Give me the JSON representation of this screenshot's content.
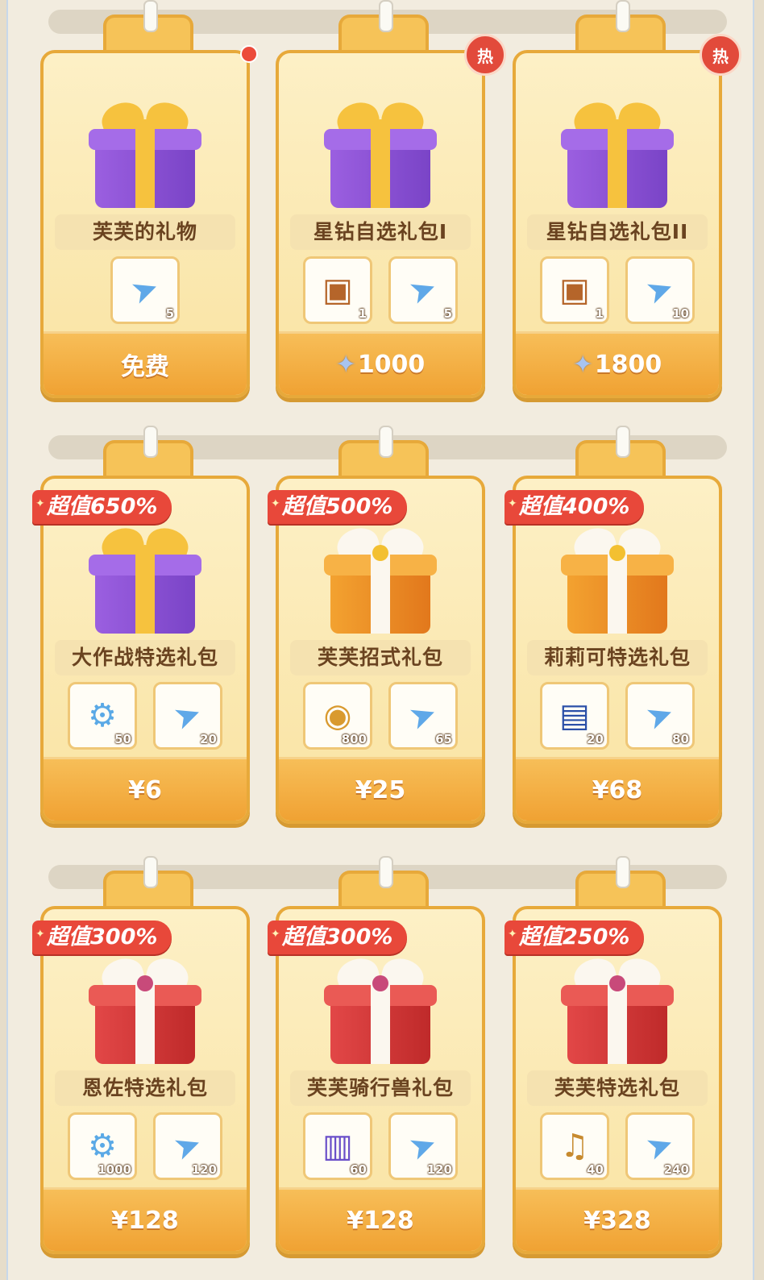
{
  "badges": {
    "hot_label": "热"
  },
  "rows": [
    {
      "cards": [
        {
          "gift": "purple-gift",
          "ribbon": "",
          "hot": false,
          "red_dot": true,
          "title": "芙芙的礼物",
          "price": "免费",
          "currency": "",
          "items": [
            {
              "icon": "paper-plane-icon",
              "qty": "5"
            }
          ]
        },
        {
          "gift": "purple-gift",
          "ribbon": "",
          "hot": true,
          "red_dot": false,
          "title": "星钻自选礼包I",
          "price": "1000",
          "currency": "star-diamond-icon",
          "items": [
            {
              "icon": "treasure-chest-icon",
              "qty": "1"
            },
            {
              "icon": "paper-plane-icon",
              "qty": "5"
            }
          ]
        },
        {
          "gift": "purple-gift",
          "ribbon": "",
          "hot": true,
          "red_dot": false,
          "title": "星钻自选礼包II",
          "price": "1800",
          "currency": "star-diamond-icon",
          "items": [
            {
              "icon": "treasure-chest-icon",
              "qty": "1"
            },
            {
              "icon": "paper-plane-icon",
              "qty": "10"
            }
          ]
        }
      ]
    },
    {
      "cards": [
        {
          "gift": "purple-gift",
          "ribbon": "超值650%",
          "hot": false,
          "red_dot": false,
          "title": "大作战特选礼包",
          "price": "¥6",
          "currency": "",
          "items": [
            {
              "icon": "energy-core-icon",
              "qty": "50"
            },
            {
              "icon": "paper-plane-icon",
              "qty": "20"
            }
          ]
        },
        {
          "gift": "orange-gift",
          "ribbon": "超值500%",
          "hot": false,
          "red_dot": false,
          "title": "芙芙招式礼包",
          "price": "¥25",
          "currency": "",
          "items": [
            {
              "icon": "crystal-orb-icon",
              "qty": "800"
            },
            {
              "icon": "paper-plane-icon",
              "qty": "65"
            }
          ]
        },
        {
          "gift": "orange-gift",
          "ribbon": "超值400%",
          "hot": false,
          "red_dot": false,
          "title": "莉莉可特选礼包",
          "price": "¥68",
          "currency": "",
          "items": [
            {
              "icon": "skill-card-icon",
              "qty": "20"
            },
            {
              "icon": "paper-plane-icon",
              "qty": "80"
            }
          ]
        }
      ]
    },
    {
      "cards": [
        {
          "gift": "red-gift",
          "ribbon": "超值300%",
          "hot": false,
          "red_dot": false,
          "title": "恩佐特选礼包",
          "price": "¥128",
          "currency": "",
          "items": [
            {
              "icon": "energy-core-icon",
              "qty": "1000"
            },
            {
              "icon": "paper-plane-icon",
              "qty": "120"
            }
          ]
        },
        {
          "gift": "red-gift",
          "ribbon": "超值300%",
          "hot": false,
          "red_dot": false,
          "title": "芙芙骑行兽礼包",
          "price": "¥128",
          "currency": "",
          "items": [
            {
              "icon": "mount-ticket-icon",
              "qty": "60"
            },
            {
              "icon": "paper-plane-icon",
              "qty": "120"
            }
          ]
        },
        {
          "gift": "red-gift",
          "ribbon": "超值250%",
          "hot": false,
          "red_dot": false,
          "title": "芙芙特选礼包",
          "price": "¥328",
          "currency": "",
          "items": [
            {
              "icon": "lyre-icon",
              "qty": "40"
            },
            {
              "icon": "paper-plane-icon",
              "qty": "240"
            }
          ]
        }
      ]
    }
  ]
}
